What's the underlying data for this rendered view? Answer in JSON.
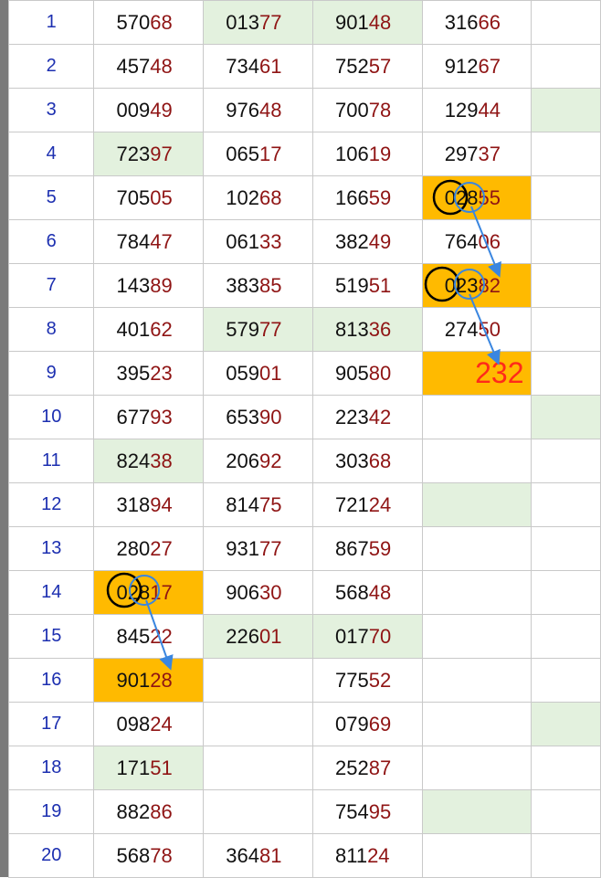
{
  "rows": [
    {
      "index": "1",
      "cells": [
        {
          "head": "570",
          "tail": "68"
        },
        {
          "head": "013",
          "tail": "77"
        },
        {
          "head": "901",
          "tail": "48"
        },
        {
          "head": "316",
          "tail": "66"
        }
      ]
    },
    {
      "index": "2",
      "cells": [
        {
          "head": "457",
          "tail": "48"
        },
        {
          "head": "734",
          "tail": "61"
        },
        {
          "head": "752",
          "tail": "57"
        },
        {
          "head": "912",
          "tail": "67"
        }
      ]
    },
    {
      "index": "3",
      "cells": [
        {
          "head": "009",
          "tail": "49"
        },
        {
          "head": "976",
          "tail": "48"
        },
        {
          "head": "700",
          "tail": "78"
        },
        {
          "head": "129",
          "tail": "44"
        }
      ]
    },
    {
      "index": "4",
      "cells": [
        {
          "head": "723",
          "tail": "97"
        },
        {
          "head": "065",
          "tail": "17"
        },
        {
          "head": "106",
          "tail": "19"
        },
        {
          "head": "297",
          "tail": "37"
        }
      ]
    },
    {
      "index": "5",
      "cells": [
        {
          "head": "705",
          "tail": "05"
        },
        {
          "head": "102",
          "tail": "68"
        },
        {
          "head": "166",
          "tail": "59"
        },
        {
          "head": "028",
          "tail": "55"
        }
      ]
    },
    {
      "index": "6",
      "cells": [
        {
          "head": "784",
          "tail": "47"
        },
        {
          "head": "061",
          "tail": "33"
        },
        {
          "head": "382",
          "tail": "49"
        },
        {
          "head": "764",
          "tail": "06"
        }
      ]
    },
    {
      "index": "7",
      "cells": [
        {
          "head": "143",
          "tail": "89"
        },
        {
          "head": "383",
          "tail": "85"
        },
        {
          "head": "519",
          "tail": "51"
        },
        {
          "head": "023",
          "tail": "82"
        }
      ]
    },
    {
      "index": "8",
      "cells": [
        {
          "head": "401",
          "tail": "62"
        },
        {
          "head": "579",
          "tail": "77"
        },
        {
          "head": "813",
          "tail": "36"
        },
        {
          "head": "274",
          "tail": "50"
        }
      ]
    },
    {
      "index": "9",
      "cells": [
        {
          "head": "395",
          "tail": "23"
        },
        {
          "head": "059",
          "tail": "01"
        },
        {
          "head": "905",
          "tail": "80"
        },
        {
          "head": "",
          "tail": ""
        }
      ]
    },
    {
      "index": "10",
      "cells": [
        {
          "head": "677",
          "tail": "93"
        },
        {
          "head": "653",
          "tail": "90"
        },
        {
          "head": "223",
          "tail": "42"
        },
        {
          "head": "",
          "tail": ""
        }
      ]
    },
    {
      "index": "11",
      "cells": [
        {
          "head": "824",
          "tail": "38"
        },
        {
          "head": "206",
          "tail": "92"
        },
        {
          "head": "303",
          "tail": "68"
        },
        {
          "head": "",
          "tail": ""
        }
      ]
    },
    {
      "index": "12",
      "cells": [
        {
          "head": "318",
          "tail": "94"
        },
        {
          "head": "814",
          "tail": "75"
        },
        {
          "head": "721",
          "tail": "24"
        },
        {
          "head": "",
          "tail": ""
        }
      ]
    },
    {
      "index": "13",
      "cells": [
        {
          "head": "280",
          "tail": "27"
        },
        {
          "head": "931",
          "tail": "77"
        },
        {
          "head": "867",
          "tail": "59"
        },
        {
          "head": "",
          "tail": ""
        }
      ]
    },
    {
      "index": "14",
      "cells": [
        {
          "head": "028",
          "tail": "17"
        },
        {
          "head": "906",
          "tail": "30"
        },
        {
          "head": "568",
          "tail": "48"
        },
        {
          "head": "",
          "tail": ""
        }
      ]
    },
    {
      "index": "15",
      "cells": [
        {
          "head": "845",
          "tail": "22"
        },
        {
          "head": "226",
          "tail": "01"
        },
        {
          "head": "017",
          "tail": "70"
        },
        {
          "head": "",
          "tail": ""
        }
      ]
    },
    {
      "index": "16",
      "cells": [
        {
          "head": "901",
          "tail": "28"
        },
        {
          "head": "",
          "tail": ""
        },
        {
          "head": "775",
          "tail": "52"
        },
        {
          "head": "",
          "tail": ""
        }
      ]
    },
    {
      "index": "17",
      "cells": [
        {
          "head": "098",
          "tail": "24"
        },
        {
          "head": "",
          "tail": ""
        },
        {
          "head": "079",
          "tail": "69"
        },
        {
          "head": "",
          "tail": ""
        }
      ]
    },
    {
      "index": "18",
      "cells": [
        {
          "head": "171",
          "tail": "51"
        },
        {
          "head": "",
          "tail": ""
        },
        {
          "head": "252",
          "tail": "87"
        },
        {
          "head": "",
          "tail": ""
        }
      ]
    },
    {
      "index": "19",
      "cells": [
        {
          "head": "882",
          "tail": "86"
        },
        {
          "head": "",
          "tail": ""
        },
        {
          "head": "754",
          "tail": "95"
        },
        {
          "head": "",
          "tail": ""
        }
      ]
    },
    {
      "index": "20",
      "cells": [
        {
          "head": "568",
          "tail": "78"
        },
        {
          "head": "364",
          "tail": "81"
        },
        {
          "head": "811",
          "tail": "24"
        },
        {
          "head": "",
          "tail": ""
        }
      ]
    }
  ],
  "prediction_label": "232",
  "colors": {
    "highlight_orange": "#ffba00",
    "highlight_green": "#e3f1de",
    "index_blue": "#1c2fb0",
    "tail_red": "#8f1414",
    "prediction_red": "#ff2a1a",
    "annotation_blue": "#3a86e0",
    "annotation_black": "#000000"
  },
  "highlights": {
    "green": [
      [
        1,
        2
      ],
      [
        1,
        3
      ],
      [
        4,
        1
      ],
      [
        3,
        5
      ],
      [
        8,
        2
      ],
      [
        8,
        3
      ],
      [
        10,
        5
      ],
      [
        11,
        1
      ],
      [
        12,
        4
      ],
      [
        15,
        2
      ],
      [
        15,
        3
      ],
      [
        17,
        5
      ],
      [
        18,
        1
      ],
      [
        19,
        4
      ]
    ],
    "orange": [
      [
        5,
        4
      ],
      [
        7,
        4
      ],
      [
        9,
        4
      ],
      [
        14,
        1
      ],
      [
        16,
        1
      ]
    ]
  }
}
